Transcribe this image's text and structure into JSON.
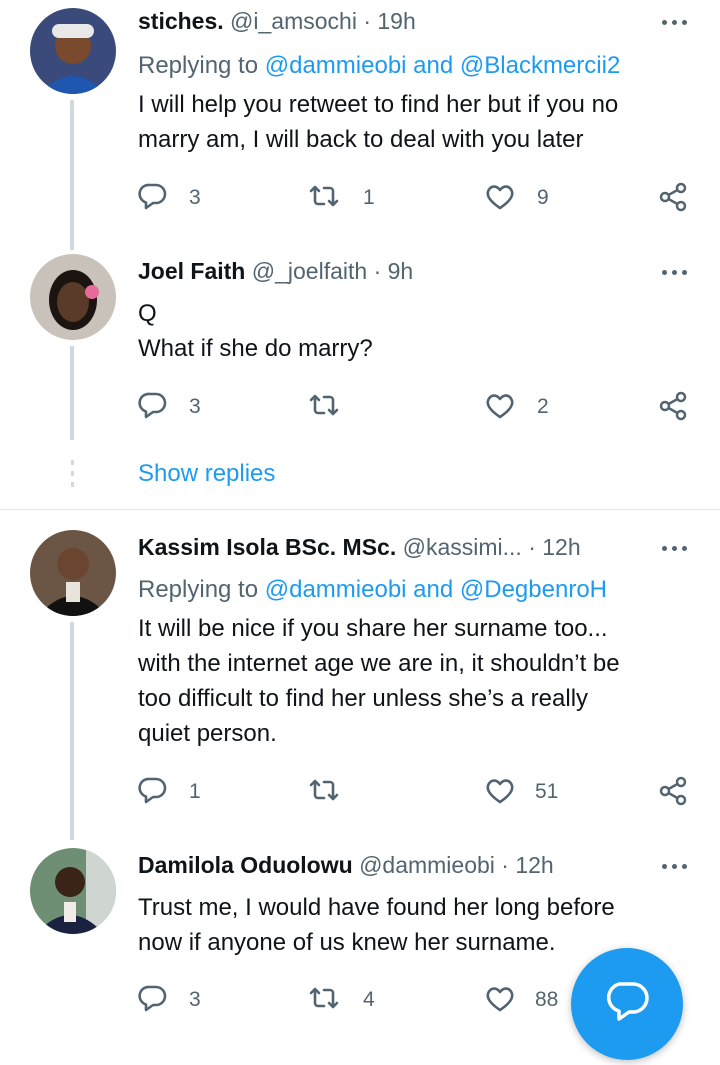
{
  "tweets": [
    {
      "name": "stiches.",
      "handle": "@i_amsochi",
      "time": "· 19h",
      "replying_prefix": "Replying to",
      "replying_a": "@dammieobi",
      "replying_and": "and",
      "replying_b": "@Blackmercii2",
      "lines": [
        "I will help you retweet to find her but if you no",
        "marry am, I will back to deal with you later"
      ],
      "replies": "3",
      "retweets": "1",
      "likes": "9"
    },
    {
      "name": "Joel Faith",
      "handle": "@_joelfaith",
      "time": "· 9h",
      "lines": [
        "Q",
        "What if she do marry?"
      ],
      "replies": "3",
      "retweets": "",
      "likes": "2"
    },
    {
      "name": "Kassim Isola BSc. MSc.",
      "handle": "@kassimi...",
      "time": "· 12h",
      "replying_prefix": "Replying to",
      "replying_a": "@dammieobi",
      "replying_and": "and",
      "replying_b": "@DegbenroH",
      "lines": [
        "It will be nice if you share her surname too...",
        "with the internet age we are in, it shouldn’t be",
        "too difficult to find her unless she’s a really",
        "quiet person."
      ],
      "replies": "1",
      "retweets": "",
      "likes": "51"
    },
    {
      "name": "Damilola Oduolowu",
      "handle": "@dammieobi",
      "time": "· 12h",
      "lines": [
        "Trust me, I would have found her long before",
        "now if anyone of us knew her surname."
      ],
      "replies": "3",
      "retweets": "4",
      "likes": "88"
    }
  ],
  "show_replies": "Show replies",
  "colors": {
    "accent": "#1d9bf0",
    "muted": "#536471",
    "text": "#0f1419",
    "line": "#cfd9de"
  },
  "icons": [
    "reply-icon",
    "retweet-icon",
    "like-icon",
    "share-icon",
    "more-icon",
    "compose-reply-icon"
  ]
}
